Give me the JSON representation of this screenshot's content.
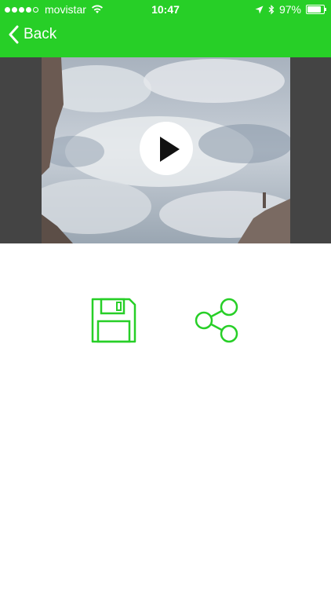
{
  "status_bar": {
    "carrier": "movistar",
    "time": "10:47",
    "battery_percent": "97%",
    "battery_level": 0.97,
    "signal_bars_filled": 4,
    "signal_bars_total": 5
  },
  "nav": {
    "back_label": "Back"
  },
  "colors": {
    "accent": "#27cf27",
    "video_bg": "#444444"
  },
  "video": {
    "thumbnail": "cloudy-sky",
    "play_icon": "play-icon"
  },
  "actions": {
    "save_icon": "floppy-disk-icon",
    "share_icon": "share-icon"
  }
}
